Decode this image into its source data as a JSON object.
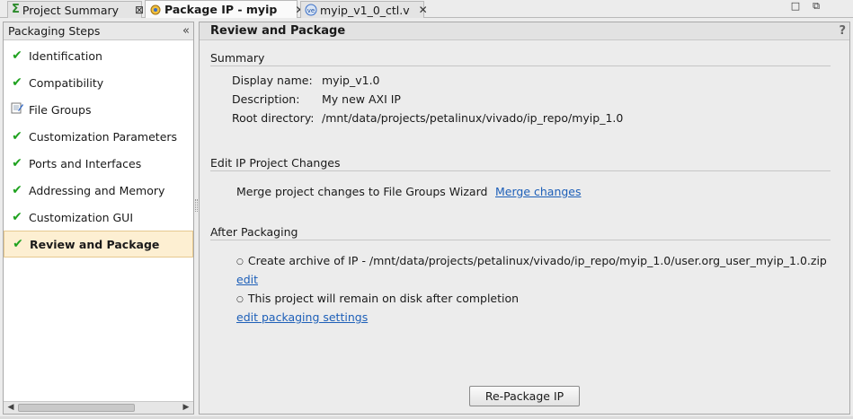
{
  "tabs": [
    {
      "label": "Project Summary",
      "close": "⊠",
      "icon": "sigma-icon"
    },
    {
      "label": "Package IP - myip",
      "close": "✕",
      "icon": "package-ip-icon"
    },
    {
      "label": "myip_v1_0_ctl.v",
      "close": "✕",
      "icon": "verilog-file-icon"
    }
  ],
  "window_controls": {
    "restore": "□",
    "maximize": "⧉"
  },
  "left_panel": {
    "title": "Packaging Steps",
    "collapse": "«",
    "steps": [
      {
        "label": "Identification",
        "status": "done"
      },
      {
        "label": "Compatibility",
        "status": "done"
      },
      {
        "label": "File Groups",
        "status": "edited"
      },
      {
        "label": "Customization Parameters",
        "status": "done"
      },
      {
        "label": "Ports and Interfaces",
        "status": "done"
      },
      {
        "label": "Addressing and Memory",
        "status": "done"
      },
      {
        "label": "Customization GUI",
        "status": "done"
      },
      {
        "label": "Review and Package",
        "status": "done",
        "active": true
      }
    ]
  },
  "right_panel": {
    "title": "Review and Package",
    "help": "?",
    "summary": {
      "title": "Summary",
      "display_name_label": "Display name:",
      "display_name_value": "myip_v1.0",
      "description_label": "Description:",
      "description_value": "My new AXI IP",
      "root_dir_label": "Root directory:",
      "root_dir_value": "/mnt/data/projects/petalinux/vivado/ip_repo/myip_1.0"
    },
    "edit_changes": {
      "title": "Edit IP Project Changes",
      "text": "Merge project changes to File Groups Wizard",
      "link": "Merge changes"
    },
    "after_packaging": {
      "title": "After Packaging",
      "bullet1": "Create archive of IP - /mnt/data/projects/petalinux/vivado/ip_repo/myip_1.0/user.org_user_myip_1.0.zip",
      "edit_link": "edit",
      "bullet2": "This project will remain on disk after completion",
      "settings_link": "edit packaging settings"
    },
    "button": "Re-Package IP"
  },
  "colors": {
    "check": "#1fa21f",
    "link": "#1d5fb8",
    "active_step": "#fdefd2"
  }
}
